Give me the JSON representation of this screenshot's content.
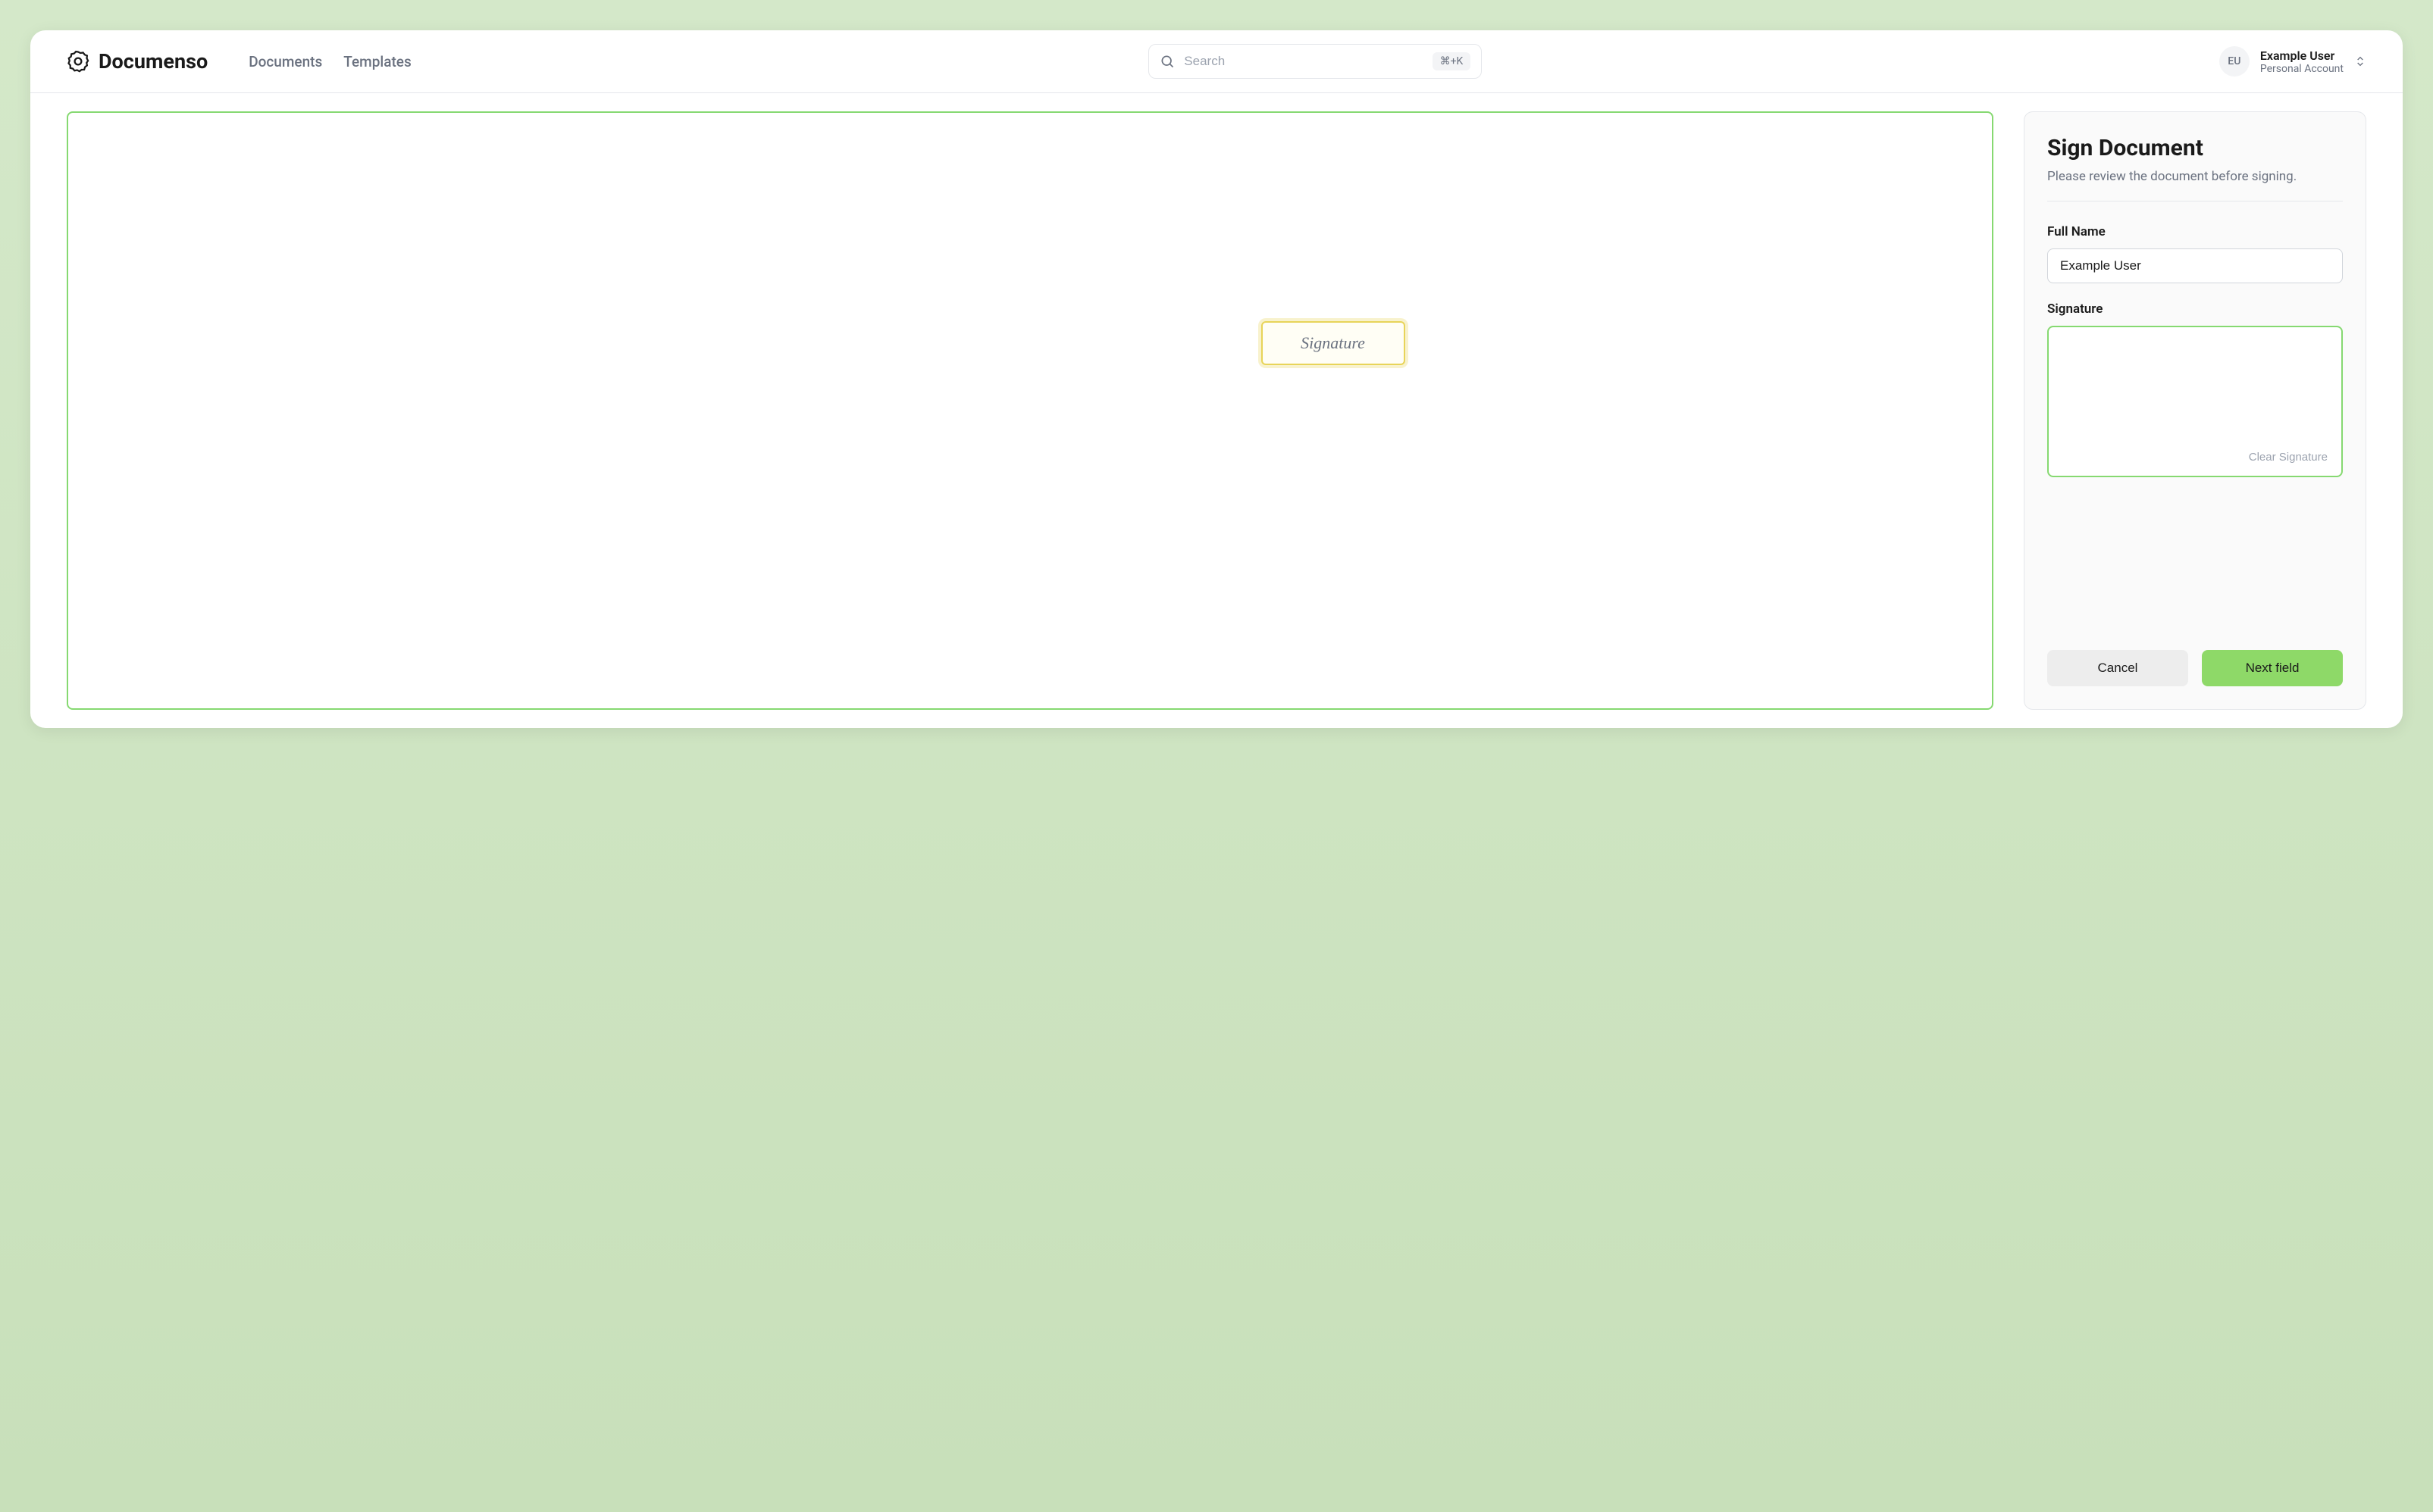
{
  "brand": {
    "name": "Documenso"
  },
  "nav": {
    "documents": "Documents",
    "templates": "Templates"
  },
  "search": {
    "placeholder": "Search",
    "shortcut": "⌘+K"
  },
  "user": {
    "initials": "EU",
    "name": "Example User",
    "account": "Personal Account"
  },
  "document": {
    "signature_field_label": "Signature"
  },
  "sidebar": {
    "title": "Sign Document",
    "subtitle": "Please review the document before signing.",
    "full_name_label": "Full Name",
    "full_name_value": "Example User",
    "signature_label": "Signature",
    "clear_signature": "Clear Signature",
    "cancel": "Cancel",
    "next_field": "Next field"
  }
}
